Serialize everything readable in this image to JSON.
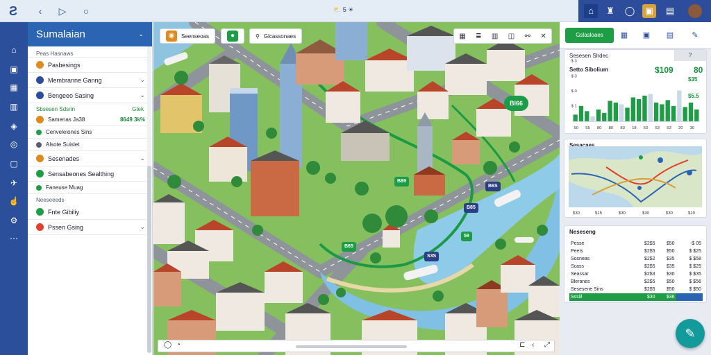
{
  "topbar": {
    "center_text": "⛅ 5 ☀",
    "icons": [
      "app-logo-icon",
      "back-icon",
      "play-icon",
      "chat-icon",
      "home-icon",
      "person-icon",
      "message-icon",
      "badge-icon",
      "calendar-icon",
      "avatar"
    ]
  },
  "sidebar": {
    "title": "Sumalaian",
    "subtitle": "Peas Hasnaws",
    "items": [
      {
        "label": "Pasbesings",
        "color": "#e08a1e"
      },
      {
        "label": "Membranne Ganng",
        "color": "#2d4d9c"
      },
      {
        "label": "Bengeeo Sasing",
        "color": "#2d4d9c"
      }
    ],
    "section1_label": "Sbsesen Sdsrin",
    "section1_right": "Gtek",
    "stat_items": [
      {
        "label": "Samenas Ja38",
        "value": "8649 3k%",
        "color": "#e08a1e"
      },
      {
        "label": "Cenveleiones Sins",
        "color": "#1f9d46"
      },
      {
        "label": "Alsote Suislet",
        "color": "#556070"
      }
    ],
    "items2": [
      {
        "label": "Sesenades",
        "color": "#e08a1e"
      },
      {
        "label": "Sensabeones Sealthing",
        "color": "#1f9d46"
      },
      {
        "label": "Faneuse Muag",
        "color": "#1f9d46"
      }
    ],
    "section2_label": "Neeseeeds",
    "items3": [
      {
        "label": "Fnte Gibiliy",
        "color": "#1f9d46"
      },
      {
        "label": "Pssen Gsing",
        "color": "#e0402a"
      }
    ]
  },
  "map": {
    "chip1_label": "Seenseoas",
    "chip3_label": "Glcassonaes",
    "tool_icons": [
      "stack-icon",
      "layers-icon",
      "ruler-icon",
      "camera-icon",
      "share-icon",
      "close-icon"
    ],
    "pins": [
      {
        "text": "Bl66",
        "kind": "g"
      },
      {
        "text": "B89",
        "kind": "g"
      },
      {
        "text": "B6S",
        "kind": "b"
      },
      {
        "text": "B85",
        "kind": "b"
      },
      {
        "text": "59",
        "kind": "g"
      },
      {
        "text": "B65",
        "kind": "g"
      },
      {
        "text": "S3S",
        "kind": "b"
      }
    ]
  },
  "right_panel": {
    "button_label": "Gslasloaes",
    "card1": {
      "title": "Sesesen Shdec",
      "badge": "?",
      "subtitle": "Setto Sibolium",
      "kpi1": "$109",
      "kpi2": "80",
      "row1": "$35",
      "row2": "$5.5",
      "y_ticks": [
        "$ 3",
        "$ 3",
        "$ 0",
        "$ 1"
      ],
      "x_ticks": [
        "50",
        "55",
        "80",
        "80",
        "83",
        "18",
        "50",
        "53",
        "53",
        "20",
        "30"
      ],
      "colors": {
        "bar": "#1f9d46",
        "bar_light": "#c9d9e6"
      }
    },
    "card1_chart": {
      "type": "bar",
      "values": [
        20,
        45,
        30,
        15,
        35,
        25,
        60,
        55,
        50,
        40,
        70,
        65,
        75,
        80,
        55,
        50,
        62,
        45,
        90,
        42,
        55,
        35
      ]
    },
    "card2": {
      "title": "Sesacaes",
      "x_ticks": [
        "$30",
        "$15",
        "$30",
        "$30",
        "$30",
        "$10"
      ]
    },
    "card3": {
      "title": "Neseseng",
      "rows": [
        [
          "Pesse",
          "$2$5",
          "$50",
          "-$ 05"
        ],
        [
          "Peets",
          "$2$5",
          "$50",
          "$ $25"
        ],
        [
          "Sosneas",
          "$2$2",
          "$35",
          "$ $58"
        ],
        [
          "Scass",
          "$2$5",
          "$35",
          "$ $25"
        ],
        [
          "Seassar",
          "$2$3",
          "$30",
          "$ $35"
        ],
        [
          "Bleranes",
          "$2$5",
          "$50",
          "$ $56"
        ],
        [
          "Sesesene Sins",
          "$2$5",
          "$50",
          "$ $50"
        ]
      ],
      "footer": [
        "Sssiil",
        "$30",
        "$36",
        ""
      ]
    }
  }
}
